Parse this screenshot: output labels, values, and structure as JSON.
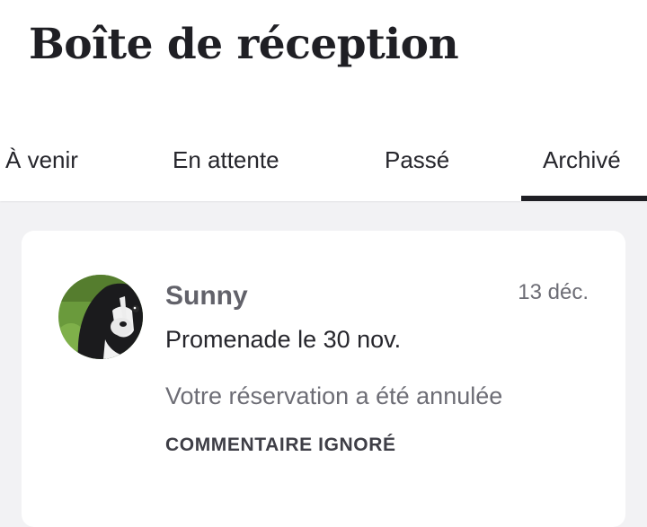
{
  "header": {
    "title": "Boîte de réception"
  },
  "tabs": [
    {
      "label": "À venir",
      "active": false
    },
    {
      "label": "En attente",
      "active": false
    },
    {
      "label": "Passé",
      "active": false
    },
    {
      "label": "Archivé",
      "active": true
    }
  ],
  "conversation": {
    "sender_name": "Sunny",
    "date": "13 déc.",
    "service": "Promenade le 30 nov.",
    "preview": "Votre réservation a été annulée",
    "status": "COMMENTAIRE IGNORÉ"
  },
  "colors": {
    "background": "#f2f2f4",
    "card": "#ffffff",
    "text_primary": "#1f1f24",
    "text_secondary": "#6d6d75",
    "active_tab_indicator": "#1f1f24"
  }
}
